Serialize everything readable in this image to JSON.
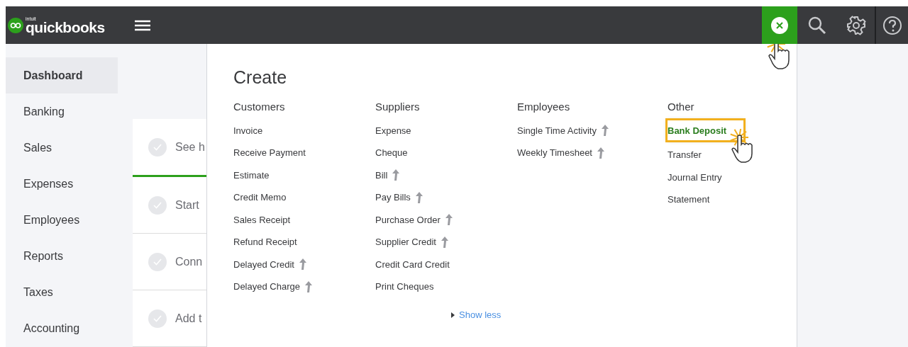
{
  "topbar": {
    "logo_small": "intuit",
    "logo": "quickbooks"
  },
  "sidebar": {
    "items": [
      {
        "label": "Dashboard",
        "selected": true
      },
      {
        "label": "Banking",
        "selected": false
      },
      {
        "label": "Sales",
        "selected": false
      },
      {
        "label": "Expenses",
        "selected": false
      },
      {
        "label": "Employees",
        "selected": false
      },
      {
        "label": "Reports",
        "selected": false
      },
      {
        "label": "Taxes",
        "selected": false
      },
      {
        "label": "Accounting",
        "selected": false
      }
    ]
  },
  "checklist": [
    {
      "label": "See h",
      "active": true
    },
    {
      "label": "Start",
      "active": false
    },
    {
      "label": "Conn",
      "active": false
    },
    {
      "label": "Add t",
      "active": false
    }
  ],
  "create_menu": {
    "title": "Create",
    "columns": [
      {
        "heading": "Customers",
        "items": [
          {
            "label": "Invoice",
            "upgrade": false,
            "selected": false
          },
          {
            "label": "Receive Payment",
            "upgrade": false,
            "selected": false
          },
          {
            "label": "Estimate",
            "upgrade": false,
            "selected": false
          },
          {
            "label": "Credit Memo",
            "upgrade": false,
            "selected": false
          },
          {
            "label": "Sales Receipt",
            "upgrade": false,
            "selected": false
          },
          {
            "label": "Refund Receipt",
            "upgrade": false,
            "selected": false
          },
          {
            "label": "Delayed Credit",
            "upgrade": true,
            "selected": false
          },
          {
            "label": "Delayed Charge",
            "upgrade": true,
            "selected": false
          }
        ]
      },
      {
        "heading": "Suppliers",
        "items": [
          {
            "label": "Expense",
            "upgrade": false,
            "selected": false
          },
          {
            "label": "Cheque",
            "upgrade": false,
            "selected": false
          },
          {
            "label": "Bill",
            "upgrade": true,
            "selected": false
          },
          {
            "label": "Pay Bills",
            "upgrade": true,
            "selected": false
          },
          {
            "label": "Purchase Order",
            "upgrade": true,
            "selected": false
          },
          {
            "label": "Supplier Credit",
            "upgrade": true,
            "selected": false
          },
          {
            "label": "Credit Card Credit",
            "upgrade": false,
            "selected": false
          },
          {
            "label": "Print Cheques",
            "upgrade": false,
            "selected": false
          }
        ]
      },
      {
        "heading": "Employees",
        "items": [
          {
            "label": "Single Time Activity",
            "upgrade": true,
            "selected": false
          },
          {
            "label": "Weekly Timesheet",
            "upgrade": true,
            "selected": false
          }
        ]
      },
      {
        "heading": "Other",
        "items": [
          {
            "label": "Bank Deposit",
            "upgrade": false,
            "selected": true
          },
          {
            "label": "Transfer",
            "upgrade": false,
            "selected": false
          },
          {
            "label": "Journal Entry",
            "upgrade": false,
            "selected": false
          },
          {
            "label": "Statement",
            "upgrade": false,
            "selected": false
          }
        ]
      }
    ],
    "toggle": "Show less"
  }
}
